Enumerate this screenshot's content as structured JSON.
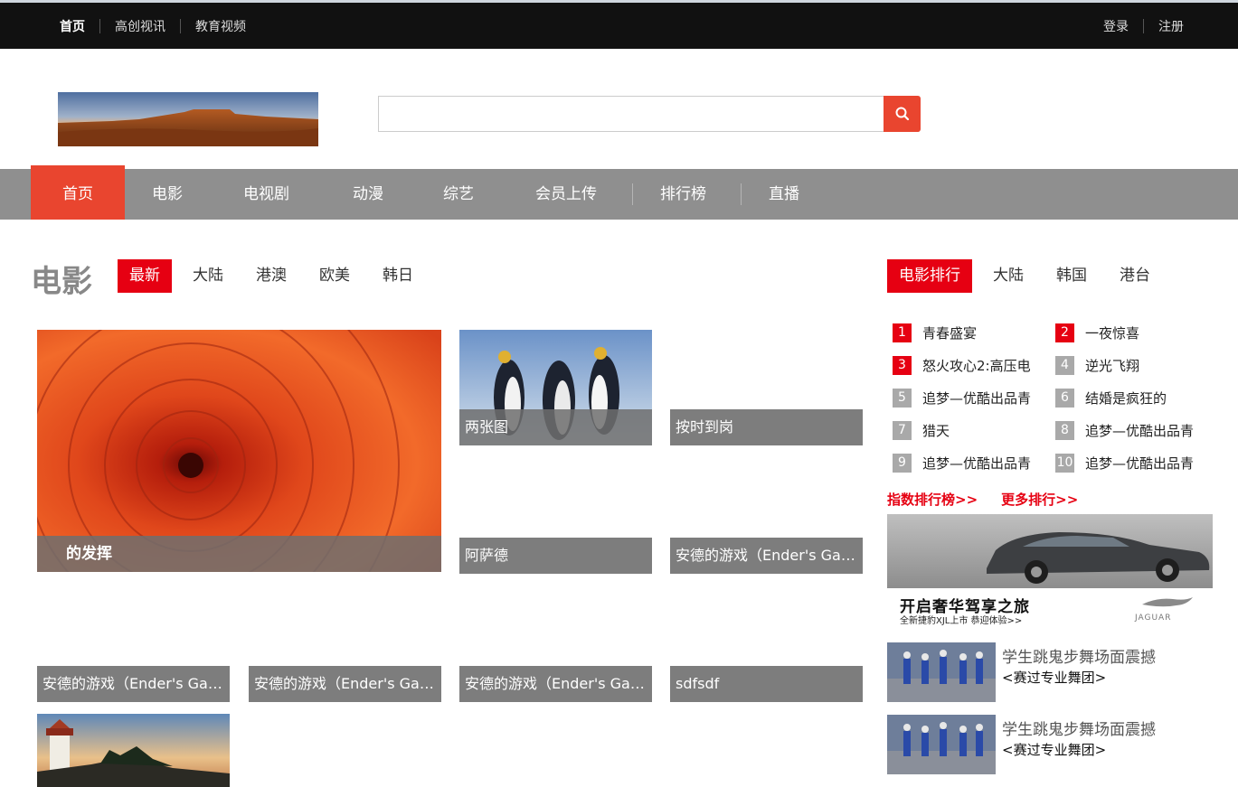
{
  "topnav": {
    "items": [
      "首页",
      "高创视讯",
      "教育视频"
    ]
  },
  "auth": {
    "login": "登录",
    "register": "注册"
  },
  "search": {
    "placeholder": "",
    "icon": "search-icon"
  },
  "mainnav": {
    "items": [
      "首页",
      "电影",
      "电视剧",
      "动漫",
      "综艺",
      "会员上传",
      "排行榜",
      "直播"
    ]
  },
  "section": {
    "title": "电影",
    "tabs": [
      "最新",
      "大陆",
      "港澳",
      "欧美",
      "韩日"
    ]
  },
  "tiles": [
    {
      "caption": "的发挥"
    },
    {
      "caption": "两张图"
    },
    {
      "caption": "按时到岗"
    },
    {
      "caption": "阿萨德"
    },
    {
      "caption": "安德的游戏（Ender's Gam..."
    },
    {
      "caption": "安德的游戏（Ender's Gam..."
    },
    {
      "caption": "安德的游戏（Ender's Gam..."
    },
    {
      "caption": "安德的游戏（Ender's Gam..."
    },
    {
      "caption": "sdfsdf"
    }
  ],
  "ranking": {
    "tabs": [
      "电影排行",
      "大陆",
      "韩国",
      "港台"
    ],
    "items": [
      {
        "num": "1",
        "title": "青春盛宴"
      },
      {
        "num": "2",
        "title": "一夜惊喜"
      },
      {
        "num": "3",
        "title": "怒火攻心2:高压电"
      },
      {
        "num": "4",
        "title": "逆光飞翔"
      },
      {
        "num": "5",
        "title": "追梦—优酷出品青"
      },
      {
        "num": "6",
        "title": "结婚是疯狂的"
      },
      {
        "num": "7",
        "title": "猎天"
      },
      {
        "num": "8",
        "title": "追梦—优酷出品青"
      },
      {
        "num": "9",
        "title": "追梦—优酷出品青"
      },
      {
        "num": "10",
        "title": "追梦—优酷出品青"
      }
    ],
    "links": [
      "指数排行榜>>",
      "更多排行>>"
    ]
  },
  "ad": {
    "headline": "开启奢华驾享之旅",
    "subline": "全新捷豹XJL上市 恭迎体验>>",
    "brand": "JAGUAR"
  },
  "videos": [
    {
      "title": "学生跳鬼步舞场面震撼",
      "subtitle": "<赛过专业舞团>"
    },
    {
      "title": "学生跳鬼步舞场面震撼",
      "subtitle": "<赛过专业舞团>"
    }
  ],
  "colors": {
    "accent": "#e9452f",
    "tab_red": "#e60012",
    "nav_gray": "#8f8f8f"
  }
}
